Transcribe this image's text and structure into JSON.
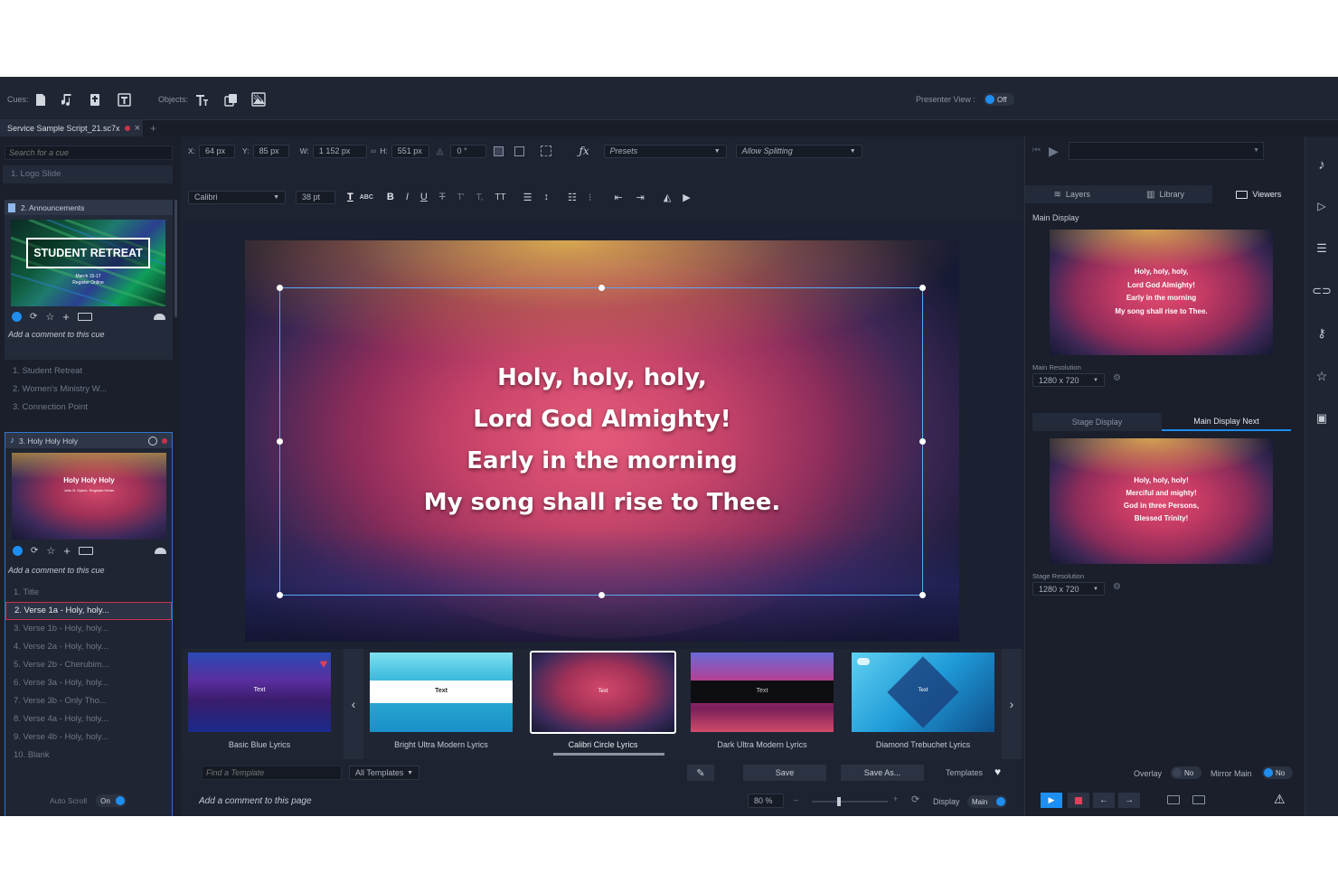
{
  "toolbar": {
    "cues_label": "Cues:",
    "objects_label": "Objects:",
    "presenter_view_label": "Presenter View :",
    "presenter_view_state": "Off"
  },
  "tabs": [
    {
      "label": "Service Sample Script_21.sc7x"
    }
  ],
  "sidebar": {
    "search_placeholder": "Search for a cue",
    "cues": [
      {
        "label": "1.  Logo Slide"
      },
      {
        "label": "2.  Announcements",
        "thumb_title": "STUDENT RETREAT",
        "thumb_sub": "March 15-17",
        "thumb_sub2": "Register Online",
        "comment": "Add a comment to this cue",
        "pages": [
          "1.  Student Retreat",
          "2.  Women's Ministry W...",
          "3.  Connection Point"
        ]
      },
      {
        "label": "3.  Holy Holy Holy",
        "thumb_title": "Holy Holy Holy",
        "thumb_sub": "John B. Dykes, Reginald Heber",
        "comment": "Add a comment to this cue",
        "pages": [
          "1.  Title",
          "2.  Verse 1a - Holy, holy...",
          "3.  Verse 1b - Holy, holy...",
          "4.  Verse 2a - Holy, holy...",
          "5.  Verse 2b - Cherubim...",
          "6.  Verse 3a - Holy, holy...",
          "7.  Verse 3b - Only Tho...",
          "8.  Verse 4a - Holy, holy...",
          "9.  Verse 4b - Holy, holy...",
          "10.  Blank"
        ]
      }
    ],
    "auto_scroll_label": "Auto Scroll",
    "auto_scroll_state": "On"
  },
  "props": {
    "x_label": "X:",
    "x": "64 px",
    "y_label": "Y:",
    "y": "85 px",
    "w_label": "W:",
    "w": "1 152 px",
    "h_label": "H:",
    "h": "551 px",
    "rotation": "0 °",
    "presets": "Presets",
    "allow_splitting": "Allow Splitting",
    "font": "Calibri",
    "font_size": "38 pt"
  },
  "slide": {
    "lines": [
      "Holy, holy, holy,",
      "Lord God Almighty!",
      "Early in the morning",
      "My song shall rise to Thee."
    ]
  },
  "templates": {
    "items": [
      {
        "name": "Basic Blue Lyrics",
        "text": "Text"
      },
      {
        "name": "Bright Ultra Modern Lyrics",
        "text": "Text"
      },
      {
        "name": "Calibri Circle Lyrics",
        "text": "Text"
      },
      {
        "name": "Dark Ultra Modern Lyrics",
        "text": "Text"
      },
      {
        "name": "Diamond Trebuchet Lyrics",
        "text": "Text"
      }
    ],
    "find_placeholder": "Find a Template",
    "filter": "All Templates",
    "save": "Save",
    "save_as": "Save As...",
    "templates_label": "Templates"
  },
  "bottom": {
    "comment": "Add a comment to this page",
    "zoom": "80 %",
    "display_label": "Display",
    "display_value": "Main"
  },
  "right": {
    "tabs": [
      "Layers",
      "Library",
      "Viewers"
    ],
    "main_display_label": "Main Display",
    "main_preview_lines": [
      "Holy, holy, holy,",
      "Lord God Almighty!",
      "Early in the morning",
      "My song shall rise to Thee."
    ],
    "main_resolution_label": "Main Resolution",
    "main_resolution": "1280 x 720",
    "subtabs": [
      "Stage Display",
      "Main Display Next"
    ],
    "next_preview_lines": [
      "Holy, holy, holy!",
      "Merciful and mighty!",
      "God in three Persons,",
      "Blessed Trinity!"
    ],
    "stage_resolution_label": "Stage Resolution",
    "stage_resolution": "1280 x 720",
    "overlay_label": "Overlay",
    "overlay_state": "No",
    "mirror_label": "Mirror Main",
    "mirror_state": "No"
  },
  "colors": {
    "accent": "#1e8ef0",
    "app_bg": "#1d2331",
    "panel_bg": "#232a39",
    "selected_border": "#c7344a"
  }
}
